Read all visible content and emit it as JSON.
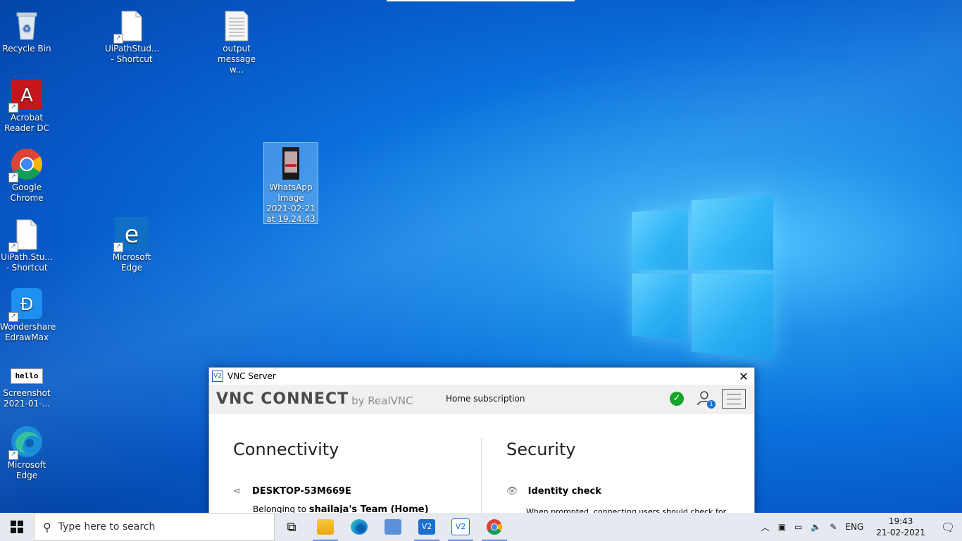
{
  "desktop": {
    "icons": [
      {
        "label": "Recycle Bin",
        "icon": "recycle-bin-icon"
      },
      {
        "label": "UiPathStud... - Shortcut",
        "icon": "file-icon"
      },
      {
        "label": "output message w...",
        "icon": "text-file-icon"
      },
      {
        "label": "Acrobat Reader DC",
        "icon": "acrobat-icon"
      },
      {
        "label": "Google Chrome",
        "icon": "chrome-icon"
      },
      {
        "label": "WhatsApp Image 2021-02-21 at 19.24.43",
        "icon": "image-icon"
      },
      {
        "label": "UiPath.Stu... - Shortcut",
        "icon": "file-icon"
      },
      {
        "label": "Microsoft Edge",
        "icon": "edge-legacy-icon"
      },
      {
        "label": "Wondershare EdrawMax",
        "icon": "edrawmax-icon"
      },
      {
        "label": "Screenshot 2021-01-...",
        "icon": "screenshot-icon"
      },
      {
        "label": "Microsoft Edge",
        "icon": "edge-icon"
      }
    ],
    "screenshot_thumb_text": "hello"
  },
  "vnc": {
    "title": "VNC Server",
    "brand": "VNC CONNECT",
    "brand_by": "by RealVNC",
    "subscription": "Home subscription",
    "status_color": "#17a52b",
    "user_badge": "1",
    "connectivity": {
      "heading": "Connectivity",
      "host": "DESKTOP-53M669E",
      "belonging_prefix": "Belonging to ",
      "team": "shailaja's Team (Home)"
    },
    "security": {
      "heading": "Security",
      "identity_title": "Identity check",
      "identity_text": "When prompted, connecting users should check for"
    }
  },
  "taskbar": {
    "search_placeholder": "Type here to search",
    "language": "ENG",
    "time": "19:43",
    "date": "21-02-2021"
  }
}
